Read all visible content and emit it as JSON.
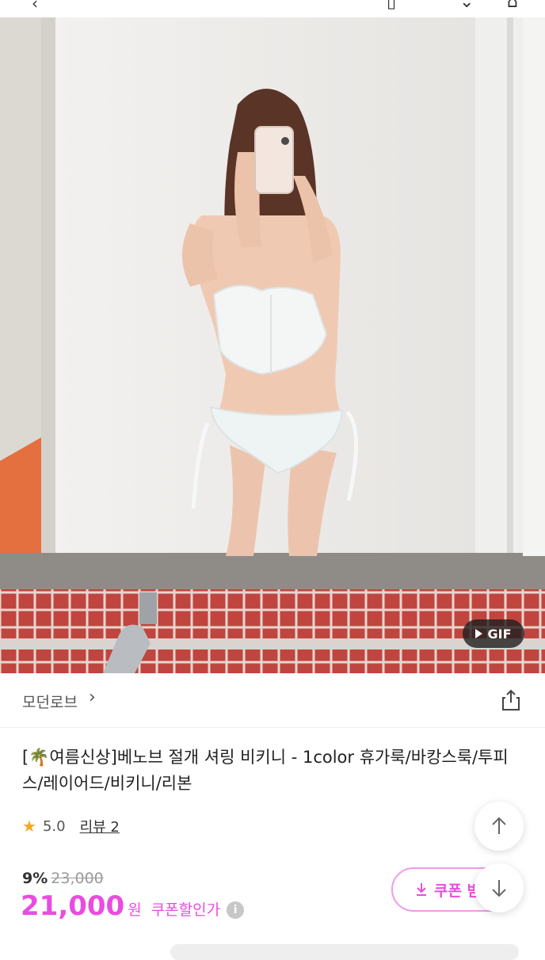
{
  "hero": {
    "gif_label": "GIF"
  },
  "store": {
    "name": "모던로브",
    "chevron": "›"
  },
  "product": {
    "title": "[🌴여름신상]베노브 절개 셔링 비키니 - 1color 휴가룩/바캉스룩/투피스/레이어드/비키니/리본",
    "rating": "5.0",
    "review_label": "리뷰 2",
    "discount_pct": "9%",
    "original_price": "23,000",
    "price": "21,000",
    "price_unit": "원",
    "coupon_note": "쿠폰할인가",
    "info_glyph": "i"
  },
  "coupon_button": {
    "label": "쿠폰 받",
    "icon": "download-icon"
  },
  "colors": {
    "accent": "#e94ce0",
    "accent_border": "#f09ae9",
    "star": "#f6a623",
    "tile_red": "#c0453f"
  }
}
